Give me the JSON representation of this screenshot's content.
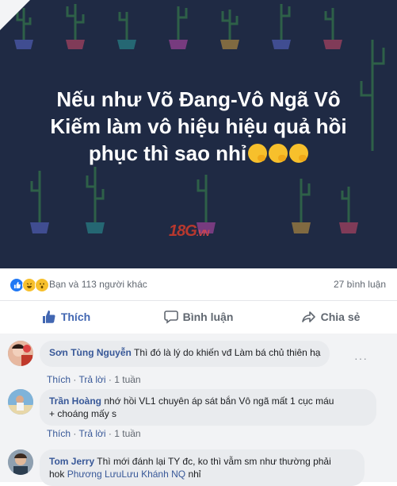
{
  "post": {
    "headline_line1": "Nếu như Võ Đang-Vô Ngã Vô",
    "headline_line2": "Kiếm làm vô hiệu hiệu quả hồi",
    "headline_line3": "phục thì sao nhỉ",
    "watermark_logo": "18G",
    "watermark_suffix": ".VN",
    "emoji_icon": "thinking-face",
    "background_color": "#1f2a44"
  },
  "reactions": {
    "icons": [
      "like",
      "haha",
      "wow"
    ],
    "summary": "Bạn và 113 người khác",
    "comment_count": "27 bình luận"
  },
  "actions": {
    "like": "Thích",
    "comment": "Bình luận",
    "share": "Chia sẻ"
  },
  "comments": [
    {
      "name": "Sơn Tùng Nguyễn",
      "text": "Thì đó là lý do khiến vđ Làm bá chủ thiên hạ",
      "like": "Thích",
      "reply": "Trả lời",
      "time": "1 tuần"
    },
    {
      "name": "Trần Hoàng",
      "text_line1": "nhớ hồi VL1 chuyên áp sát bắn Vô ngã mất 1 cục máu",
      "text_line2": "+ choáng mấy s",
      "like": "Thích",
      "reply": "Trả lời",
      "time": "1 tuần"
    },
    {
      "name": "Tom Jerry",
      "text_line1": "Thì mới đánh lại TY đc, ko thì vẫm sm như thường phải",
      "text_pre": "hok",
      "tag1": "Phương Lưu",
      "tag2": "Lưu Khánh NQ",
      "text_post": "nhỉ"
    }
  ],
  "colors": {
    "accent": "#4267b2",
    "name_link": "#385898",
    "like_reaction": "#2078f4"
  }
}
